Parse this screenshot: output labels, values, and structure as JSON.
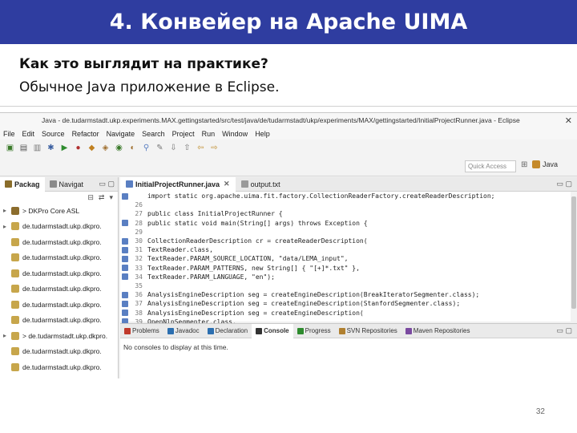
{
  "slide": {
    "title": "4. Конвейер на Apache UIMA",
    "line1": "Как это выглядит на практике?",
    "line2": "Обычное Java приложение в Eclipse.",
    "page_number": "32"
  },
  "eclipse": {
    "window_title": "Java - de.tudarmstadt.ukp.experiments.MAX.gettingstarted/src/test/java/de/tudarmstadt/ukp/experiments/MAX/gettingstarted/InitialProjectRunner.java - Eclipse",
    "menu": [
      "File",
      "Edit",
      "Source",
      "Refactor",
      "Navigate",
      "Search",
      "Project",
      "Run",
      "Window",
      "Help"
    ],
    "quick_access_placeholder": "Quick Access",
    "perspective": "Java",
    "left_tabs": [
      "Packag",
      "Navigat"
    ],
    "tree": [
      {
        "label": "> DKPro Core ASL",
        "type": "project",
        "arrow": "▸"
      },
      {
        "label": "de.tudarmstadt.ukp.dkpro.",
        "type": "package",
        "arrow": "▸"
      },
      {
        "label": "de.tudarmstadt.ukp.dkpro.",
        "type": "package",
        "arrow": ""
      },
      {
        "label": "de.tudarmstadt.ukp.dkpro.",
        "type": "package",
        "arrow": ""
      },
      {
        "label": "de.tudarmstadt.ukp.dkpro.",
        "type": "package",
        "arrow": ""
      },
      {
        "label": "de.tudarmstadt.ukp.dkpro.",
        "type": "package",
        "arrow": ""
      },
      {
        "label": "de.tudarmstadt.ukp.dkpro.",
        "type": "package",
        "arrow": ""
      },
      {
        "label": "de.tudarmstadt.ukp.dkpro.",
        "type": "package",
        "arrow": ""
      },
      {
        "label": "> de.tudarmstadt.ukp.dkpro.",
        "type": "package",
        "arrow": "▸"
      },
      {
        "label": "de.tudarmstadt.ukp.dkpro.",
        "type": "package",
        "arrow": ""
      },
      {
        "label": "de.tudarmstadt.ukp.dkpro.",
        "type": "package",
        "arrow": ""
      },
      {
        "label": "de.tudarmstadt.ukp.dkpro.",
        "type": "package",
        "arrow": ""
      }
    ],
    "editor_tabs": [
      "InitialProjectRunner.java",
      "output.txt"
    ],
    "code": [
      {
        "ln": "",
        "text": "import static org.apache.uima.fit.factory.CollectionReaderFactory.createReaderDescription;",
        "mark": true
      },
      {
        "ln": "26",
        "text": "",
        "mark": false
      },
      {
        "ln": "27",
        "text": "public class InitialProjectRunner {",
        "mark": false
      },
      {
        "ln": "28",
        "text": "    public static void main(String[] args) throws Exception {",
        "mark": true
      },
      {
        "ln": "29",
        "text": "",
        "mark": false
      },
      {
        "ln": "30",
        "text": "        CollectionReaderDescription cr = createReaderDescription(",
        "mark": true
      },
      {
        "ln": "31",
        "text": "                TextReader.class,",
        "mark": true
      },
      {
        "ln": "32",
        "text": "                TextReader.PARAM_SOURCE_LOCATION, \"data/LEMA_input\",",
        "mark": true
      },
      {
        "ln": "33",
        "text": "                TextReader.PARAM_PATTERNS, new String[] { \"[+]*.txt\" },",
        "mark": true
      },
      {
        "ln": "34",
        "text": "                TextReader.PARAM_LANGUAGE, \"en\");",
        "mark": true
      },
      {
        "ln": "35",
        "text": "",
        "mark": false
      },
      {
        "ln": "36",
        "text": "        AnalysisEngineDescription seg = createEngineDescription(BreakIteratorSegmenter.class);",
        "mark": true
      },
      {
        "ln": "37",
        "text": "        AnalysisEngineDescription seg = createEngineDescription(StanfordSegmenter.class);",
        "mark": true
      },
      {
        "ln": "38",
        "text": "        AnalysisEngineDescription seg = createEngineDescription(",
        "mark": true
      },
      {
        "ln": "39",
        "text": "                OpenNlpSegmenter.class,",
        "mark": true
      }
    ],
    "bottom_tabs": [
      "Problems",
      "Javadoc",
      "Declaration",
      "Console",
      "Progress",
      "SVN Repositories",
      "Maven Repositories"
    ],
    "console_message": "No consoles to display at this time."
  }
}
